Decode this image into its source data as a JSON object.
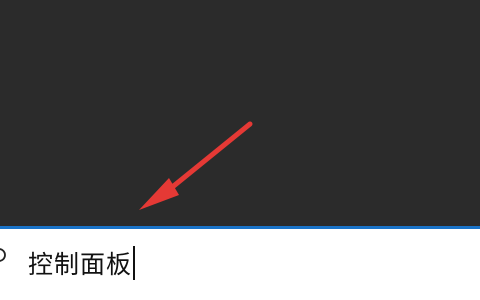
{
  "search": {
    "query": "控制面板"
  },
  "icons": {
    "search": "search-icon",
    "annotation": "red-arrow-icon"
  },
  "colors": {
    "panel_background": "#2b2b2b",
    "search_background": "#ffffff",
    "search_accent": "#1a73c8",
    "arrow": "#e53935"
  }
}
